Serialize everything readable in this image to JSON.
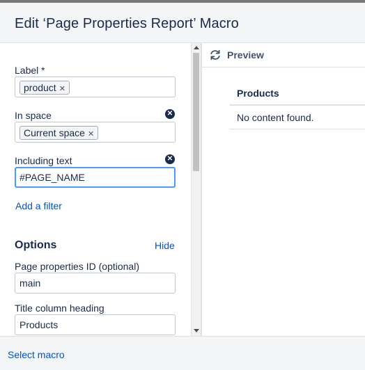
{
  "dialog": {
    "title": "Edit ‘Page Properties Report’ Macro"
  },
  "filters": {
    "label": {
      "label": "Label *",
      "tag": "product"
    },
    "space": {
      "label": "In space",
      "tag": "Current space"
    },
    "text": {
      "label": "Including text",
      "value": "#PAGE_NAME"
    },
    "add_filter": "Add a filter"
  },
  "options": {
    "title": "Options",
    "hide_link": "Hide",
    "id_field": {
      "label": "Page properties ID (optional)",
      "value": "main"
    },
    "title_field": {
      "label": "Title column heading",
      "value": "Products"
    }
  },
  "preview": {
    "label": "Preview",
    "table_header": "Products",
    "empty_message": "No content found."
  },
  "footer": {
    "select_macro": "Select macro"
  },
  "colors": {
    "link": "#0052cc",
    "focus": "#4c9aff",
    "text": "#172b4d"
  }
}
